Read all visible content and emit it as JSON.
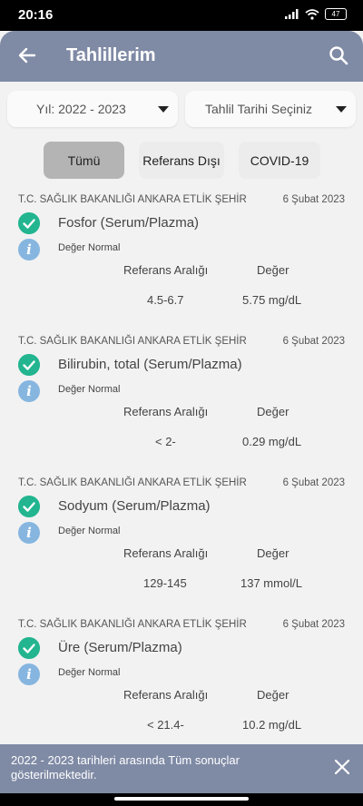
{
  "status_bar": {
    "time": "20:16",
    "battery": "47"
  },
  "app_bar": {
    "title": "Tahlillerim"
  },
  "year_dropdown": {
    "label": "Yıl: 2022 - 2023"
  },
  "date_dropdown": {
    "label": "Tahlil Tarihi Seçiniz"
  },
  "filters": [
    {
      "label": "Tümü",
      "active": true
    },
    {
      "label": "Referans Dışı",
      "active": false
    },
    {
      "label": "COVID-19",
      "active": false
    }
  ],
  "column_headers": {
    "reference": "Referans Aralığı",
    "value": "Değer"
  },
  "results": [
    {
      "institution": "T.C. SAĞLIK BAKANLIĞI ANKARA ETLİK ŞEHİR",
      "date": "6 Şubat 2023",
      "test": "Fosfor (Serum/Plazma)",
      "status": "Değer Normal",
      "reference": "4.5-6.7",
      "value": "5.75 mg/dL"
    },
    {
      "institution": "T.C. SAĞLIK BAKANLIĞI ANKARA ETLİK ŞEHİR",
      "date": "6 Şubat 2023",
      "test": "Bilirubin, total (Serum/Plazma)",
      "status": "Değer Normal",
      "reference": "< 2-",
      "value": "0.29 mg/dL"
    },
    {
      "institution": "T.C. SAĞLIK BAKANLIĞI ANKARA ETLİK ŞEHİR",
      "date": "6 Şubat 2023",
      "test": "Sodyum (Serum/Plazma)",
      "status": "Değer Normal",
      "reference": "129-145",
      "value": "137 mmol/L"
    },
    {
      "institution": "T.C. SAĞLIK BAKANLIĞI ANKARA ETLİK ŞEHİR",
      "date": "6 Şubat 2023",
      "test": "Üre (Serum/Plazma)",
      "status": "Değer Normal",
      "reference": "< 21.4-",
      "value": "10.2 mg/dL"
    }
  ],
  "snackbar": {
    "message": "2022 - 2023 tarihleri arasında Tüm sonuçlar gösterilmektedir."
  },
  "icons": {
    "back": "arrow-left-icon",
    "search": "search-icon",
    "check": "check-circle-icon",
    "info": "info-icon",
    "close": "close-icon"
  },
  "colors": {
    "app_bar": "#7f8aa5",
    "check": "#22b58f",
    "info": "#86b6e0",
    "active_chip": "#b4b4b4"
  }
}
